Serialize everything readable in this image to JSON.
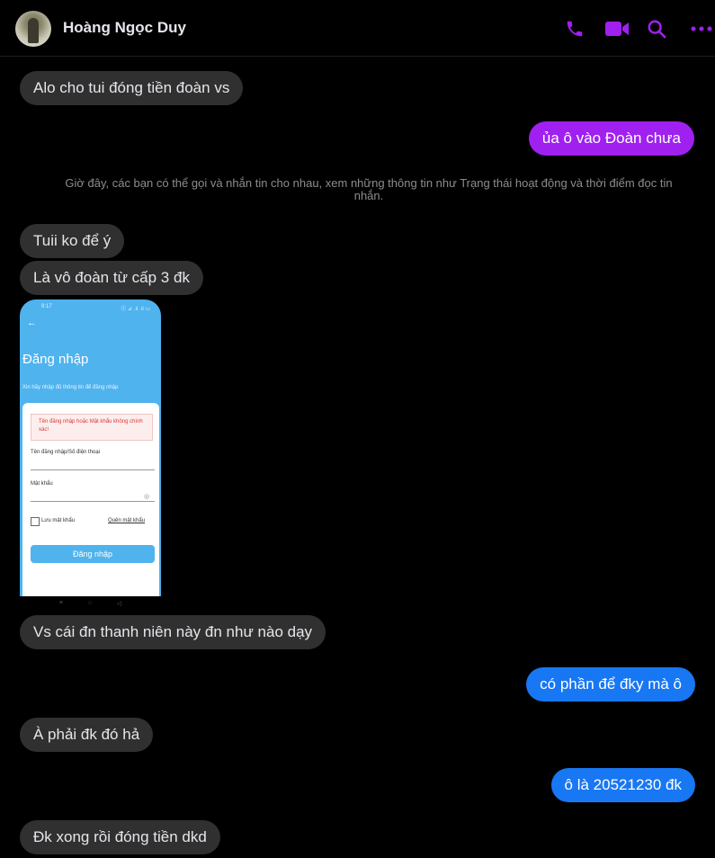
{
  "header": {
    "contact_name": "Hoàng Ngọc Duy",
    "icons": [
      "phone-icon",
      "video-camera-icon",
      "search-icon",
      "more-options-icon"
    ],
    "accent_color": "#a020f0"
  },
  "messages": [
    {
      "id": 0,
      "direction": "in",
      "text": "Alo cho tui đóng tiền đoàn vs"
    },
    {
      "id": 1,
      "direction": "out",
      "text": "ủa ô vào Đoàn chưa",
      "color": "#a020f0"
    },
    {
      "id": 2,
      "direction": "in",
      "text": "Tuii ko để ý"
    },
    {
      "id": 3,
      "direction": "in",
      "text": "Là vô đoàn từ cấp 3 đk"
    },
    {
      "id": 4,
      "direction": "in",
      "text": "Vs cái đn thanh niên này đn như nào dạy"
    },
    {
      "id": 5,
      "direction": "out",
      "text": "có phần để đky mà ô",
      "color": "#1877f2"
    },
    {
      "id": 6,
      "direction": "in",
      "text": "À phải đk đó hả"
    },
    {
      "id": 7,
      "direction": "out",
      "text": "ô là 20521230 đk",
      "color": "#1877f2"
    },
    {
      "id": 8,
      "direction": "in",
      "text": "Đk xong rồi đóng tiền dkd"
    }
  ],
  "system_note": "Giờ đây, các bạn có thể gọi và nhắn tin cho nhau, xem những thông tin như Trạng thái hoạt động và thời điểm đọc tin nhắn.",
  "attachment": {
    "status_time": "9:17",
    "status_icons": "ⓢ ⊿ .ıl .ıl ▭",
    "title": "Đăng nhập",
    "subtitle": "Xin hãy nhập đủ thông tin để đăng nhập",
    "error": "Tên đăng nhập hoặc Mật khẩu không chính xác!",
    "username_label": "Tên đăng nhập/Số điện thoại",
    "password_label": "Mật khẩu",
    "remember_label": "Lưu mật khẩu",
    "forgot_label": "Quên mật khẩu",
    "login_button": "Đăng nhập"
  }
}
